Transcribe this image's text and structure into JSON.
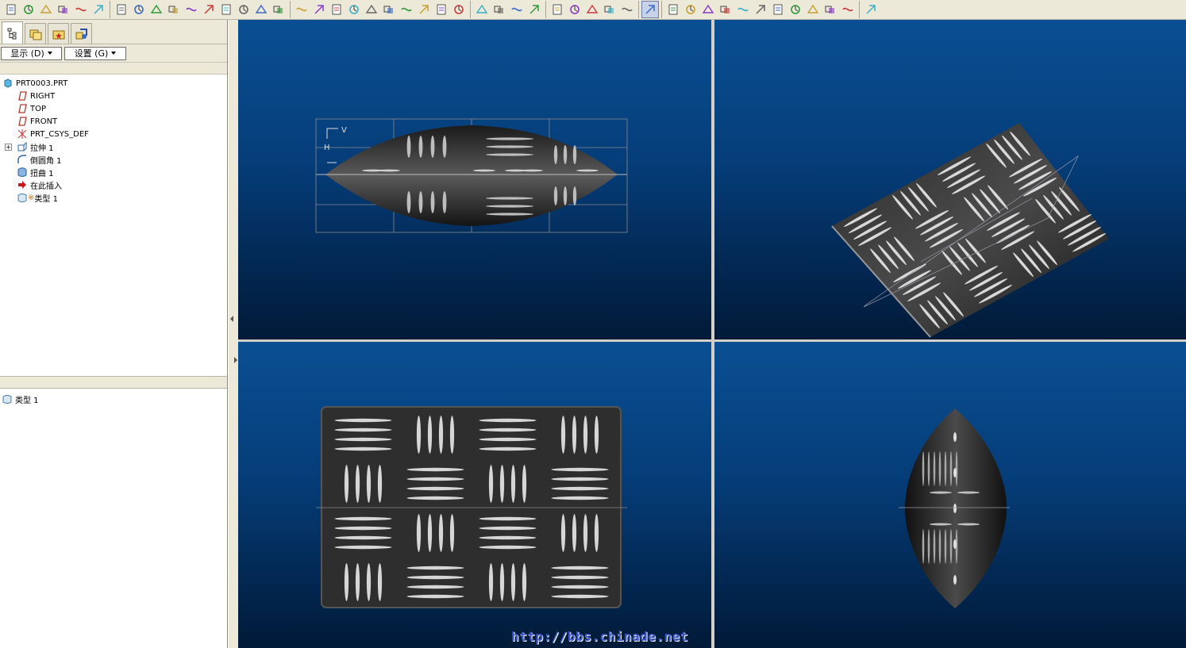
{
  "toolbar": {
    "groups": [
      [
        "new-file",
        "open-file",
        "save",
        "print",
        "print-preview",
        "print-quick"
      ],
      [
        "undo",
        "redo",
        "regenerate",
        "cut",
        "copy",
        "paste",
        "paste-special",
        "model-player",
        "find",
        "select-box"
      ],
      [
        "repaint",
        "spin-center",
        "orient",
        "zoom-in",
        "zoom-out",
        "refit",
        "reorient",
        "saved-views",
        "layers",
        "view-manager"
      ],
      [
        "wireframe",
        "hidden-line",
        "no-hidden",
        "shading"
      ],
      [
        "datum-planes",
        "datum-axes",
        "datum-points",
        "csys",
        "annotations"
      ],
      [
        "spin-center-toggle"
      ],
      [
        "sketch",
        "surface-style",
        "curve",
        "analysis-color",
        "mapkey",
        "draft-analysis",
        "reflection",
        "section-a",
        "section-b",
        "section-c",
        "section-d"
      ],
      [
        "whats-this"
      ]
    ]
  },
  "left_panel": {
    "display_menu": "显示 (D)",
    "settings_menu": "设置 (G)",
    "tree": [
      {
        "label": "PRT0003.PRT",
        "icon": "part-icon",
        "level": 0
      },
      {
        "label": "RIGHT",
        "icon": "datum-plane-icon",
        "level": 1
      },
      {
        "label": "TOP",
        "icon": "datum-plane-icon",
        "level": 1
      },
      {
        "label": "FRONT",
        "icon": "datum-plane-icon",
        "level": 1
      },
      {
        "label": "PRT_CSYS_DEF",
        "icon": "csys-icon",
        "level": 1
      },
      {
        "label": "拉伸 1",
        "icon": "extrude-icon",
        "level": 1,
        "expandable": true
      },
      {
        "label": "倒圆角 1",
        "icon": "round-icon",
        "level": 1
      },
      {
        "label": "扭曲 1",
        "icon": "warp-icon",
        "level": 1
      },
      {
        "label": "在此插入",
        "icon": "insert-here-icon",
        "level": 1
      },
      {
        "label": "类型 1",
        "icon": "texture-icon",
        "level": 1,
        "prefix": "※"
      }
    ],
    "layers": [
      {
        "label": "类型 1",
        "icon": "texture-icon"
      }
    ]
  },
  "viewports": {
    "top_left_axis_label_v": "V",
    "top_left_axis_label_h": "H"
  },
  "watermark": "http://bbs.chinade.net"
}
